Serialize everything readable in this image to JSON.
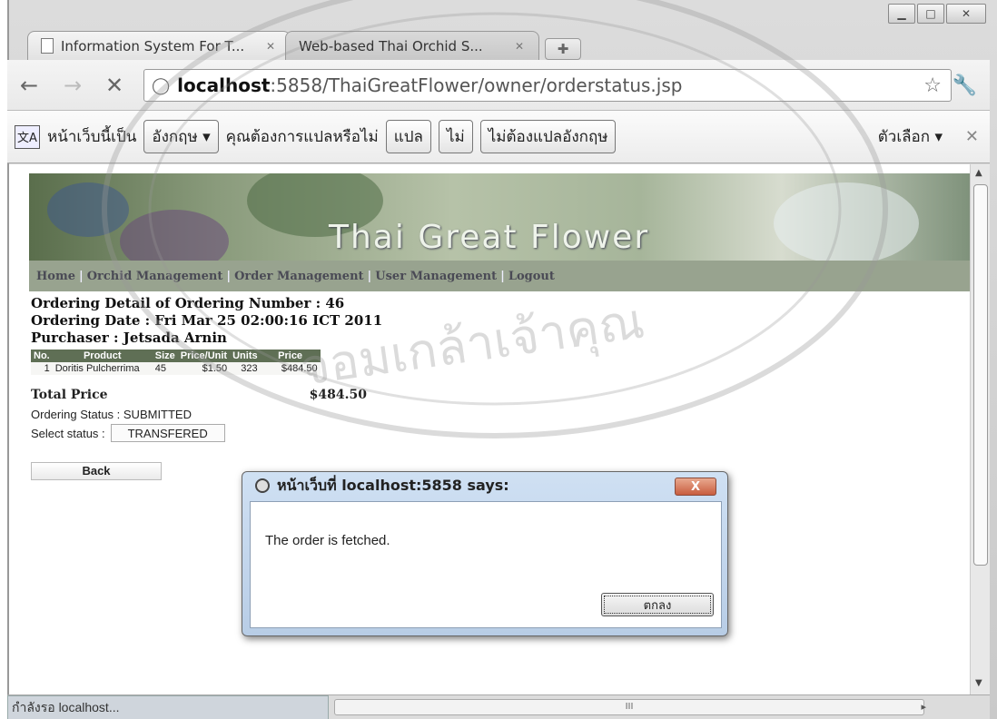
{
  "browser": {
    "tabs": [
      {
        "title": "Information System For T...",
        "active": true
      },
      {
        "title": "Web-based Thai Orchid S...",
        "active": false
      }
    ],
    "url_host": "localhost",
    "url_path": ":5858/ThaiGreatFlower/owner/orderstatus.jsp"
  },
  "translate_bar": {
    "prefix": "หน้าเว็บนี้เป็น",
    "language": "อังกฤษ",
    "question": "คุณต้องการแปลหรือไม่",
    "translate_button": "แปล",
    "no_button": "ไม่",
    "never_button": "ไม่ต้องแปลอังกฤษ",
    "options": "ตัวเลือก"
  },
  "site": {
    "banner_title": "Thai Great Flower",
    "menu": [
      "Home",
      "Orchid Management",
      "Order Management",
      "User Management",
      "Logout"
    ]
  },
  "order": {
    "number_line": "Ordering Detail of Ordering Number : 46",
    "date_line": "Ordering Date : Fri Mar 25 02:00:16 ICT 2011",
    "purchaser_line": "Purchaser : Jetsada Arnin",
    "columns": [
      "No.",
      "Product",
      "Size",
      "Price/Unit",
      "Units",
      "Price"
    ],
    "rows": [
      {
        "no": "1",
        "product": "Doritis Pulcherrima",
        "size": "45",
        "price_unit": "$1.50",
        "units": "323",
        "price": "$484.50"
      }
    ],
    "total_label": "Total Price",
    "total_value": "$484.50",
    "status_line": "Ordering Status : SUBMITTED",
    "select_label": "Select status :",
    "select_value": "TRANSFERED",
    "back_label": "Back"
  },
  "dialog": {
    "title": "หน้าเว็บที่ localhost:5858 says:",
    "message": "The order is fetched.",
    "ok_label": "ตกลง",
    "close_label": "X"
  },
  "statusbar": {
    "text": "กำลังรอ localhost...",
    "scroll_grip": "III"
  },
  "watermark": {
    "text": "จอมเกล้าเจ้าคุณ"
  },
  "colors": {
    "menu_bg": "#98a38f",
    "table_header": "#5f6f55",
    "dialog_frame": "#b8cde6"
  }
}
